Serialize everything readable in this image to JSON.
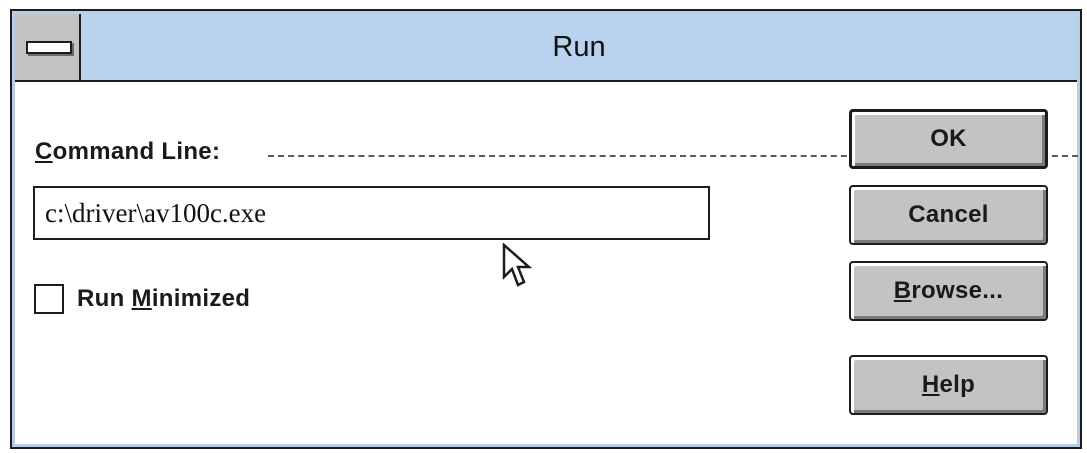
{
  "window": {
    "title": "Run"
  },
  "command_line": {
    "label_mnemonic": "C",
    "label_rest": "ommand Line:",
    "value": "c:\\driver\\av100c.exe"
  },
  "run_minimized": {
    "label_before": "Run ",
    "label_mnemonic": "M",
    "label_after": "inimized",
    "checked": false
  },
  "buttons": {
    "ok": {
      "label": "OK"
    },
    "cancel": {
      "label": "Cancel"
    },
    "browse": {
      "mnemonic": "B",
      "rest": "rowse..."
    },
    "help": {
      "mnemonic": "H",
      "rest": "elp"
    }
  },
  "icons": {
    "system_menu": "system-menu-icon",
    "cursor": "arrow-cursor-icon"
  },
  "colors": {
    "titlebar": "#b9d3ee",
    "button_face": "#c3c3c3",
    "frame": "#1c1c1c"
  }
}
